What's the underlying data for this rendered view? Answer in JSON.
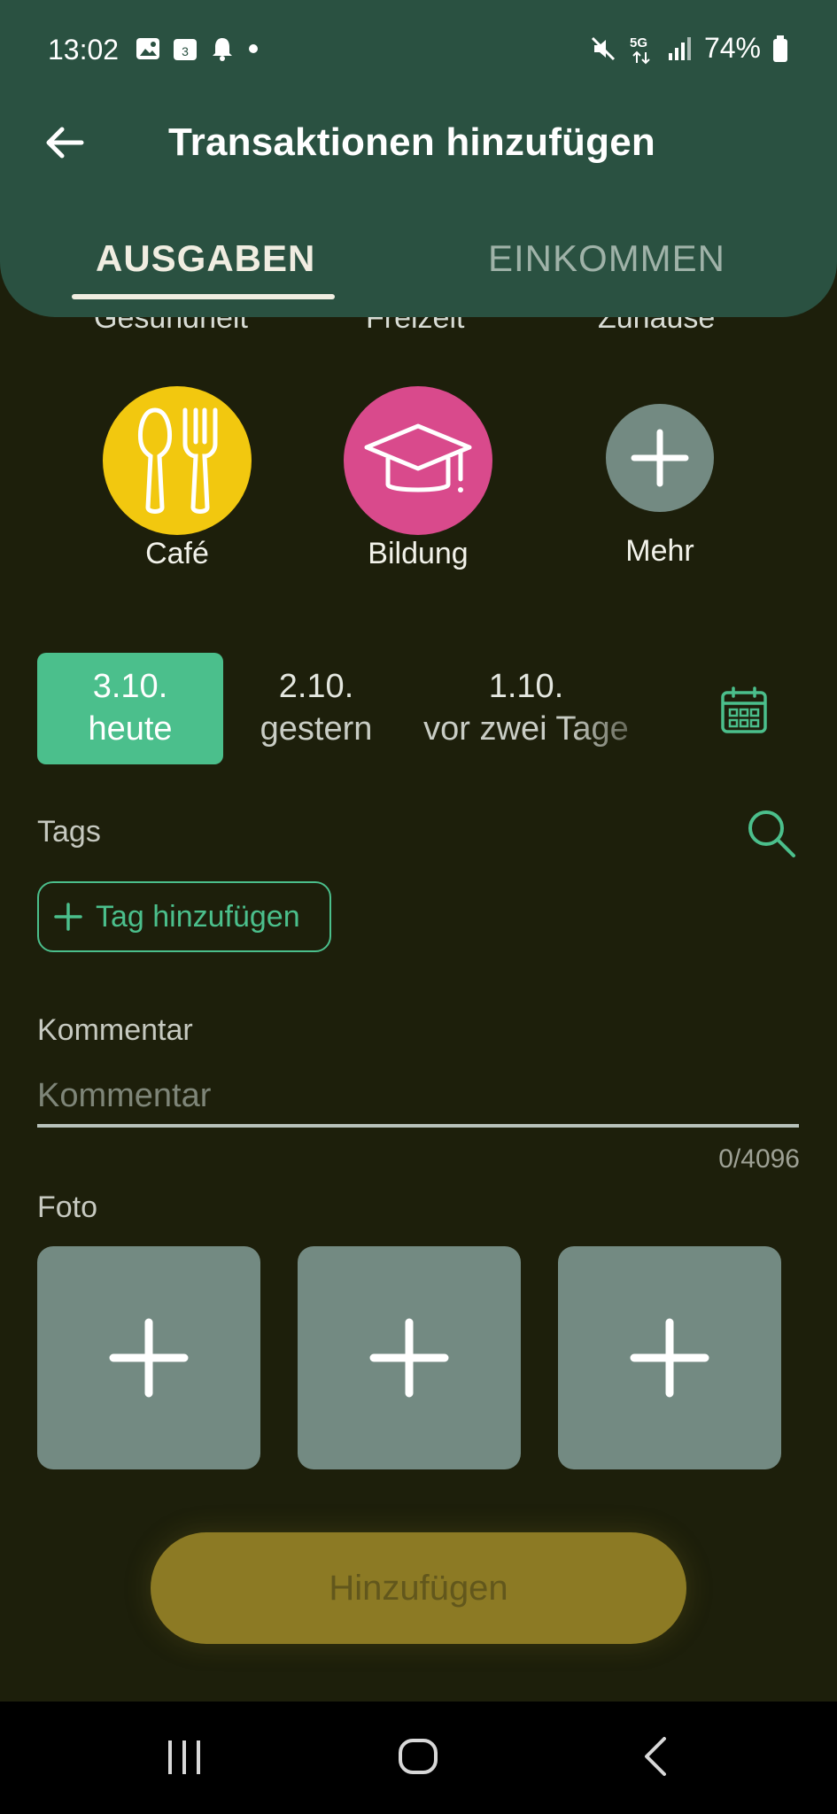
{
  "status_bar": {
    "time": "13:02",
    "battery": "74%",
    "calendar_badge": "3"
  },
  "header": {
    "title": "Transaktionen hinzufügen"
  },
  "tabs": [
    {
      "label": "AUSGABEN",
      "active": true
    },
    {
      "label": "EINKOMMEN",
      "active": false
    }
  ],
  "categories_peek": [
    "Gesundheit",
    "Freizeit",
    "Zuhause"
  ],
  "categories": [
    {
      "label": "Café",
      "color": "#f2c80f",
      "icon": "utensils-icon"
    },
    {
      "label": "Bildung",
      "color": "#d94a8c",
      "icon": "graduation-cap-icon"
    },
    {
      "label": "Mehr",
      "color": "#738a82",
      "icon": "plus-icon"
    }
  ],
  "dates": [
    {
      "date": "3.10.",
      "label": "heute",
      "active": true
    },
    {
      "date": "2.10.",
      "label": "gestern",
      "active": false
    },
    {
      "date": "1.10.",
      "label": "vor zwei Tage",
      "active": false
    }
  ],
  "tags": {
    "label": "Tags",
    "add_label": "Tag hinzufügen"
  },
  "comment": {
    "label": "Kommentar",
    "placeholder": "Kommentar",
    "value": "",
    "counter": "0/4096"
  },
  "photo": {
    "label": "Foto"
  },
  "submit": {
    "label": "Hinzufügen"
  },
  "colors": {
    "accent": "#4bbf8c",
    "header": "#2a5141",
    "background": "#1d1f0b",
    "submit": "#8c7a24"
  }
}
